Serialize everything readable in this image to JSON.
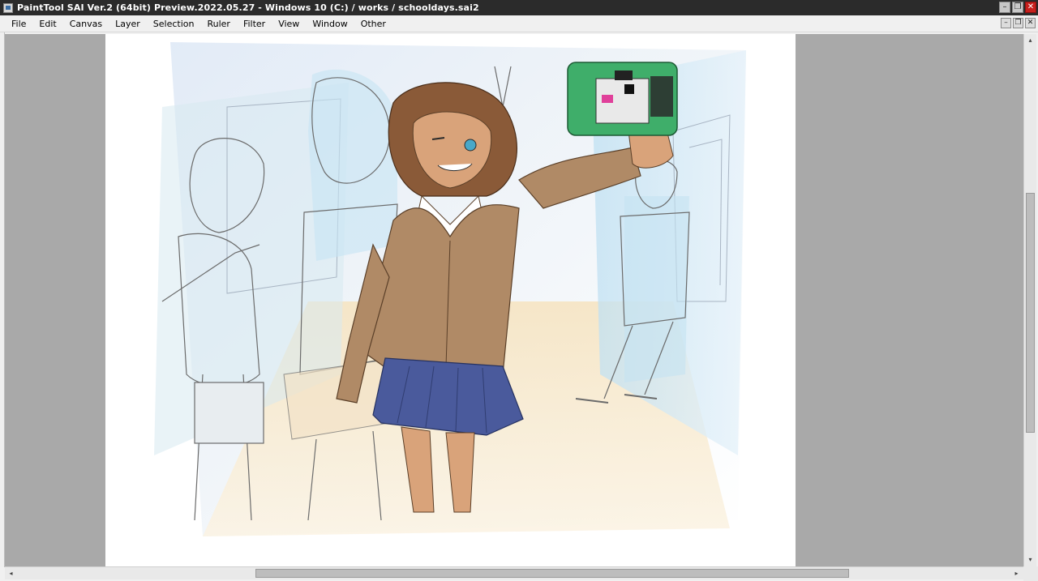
{
  "window": {
    "title": "PaintTool SAI Ver.2 (64bit) Preview.2022.05.27 - Windows 10 (C:) / works / schooldays.sai2",
    "buttons": {
      "minimize": "–",
      "restore": "❐",
      "close": "✕"
    }
  },
  "menu": {
    "items": [
      "File",
      "Edit",
      "Canvas",
      "Layer",
      "Selection",
      "Ruler",
      "Filter",
      "View",
      "Window",
      "Other"
    ]
  },
  "mdi_buttons": {
    "minimize": "–",
    "restore": "❐",
    "close": "✕"
  },
  "scrollbars": {
    "horizontal": {
      "left_arrow": "◂",
      "right_arrow": "▸",
      "position": 0.27,
      "visible_fraction": 0.58
    },
    "vertical": {
      "up_arrow": "▴",
      "down_arrow": "▾",
      "position": 0.3,
      "visible_fraction": 0.45
    }
  },
  "colors": {
    "titlebar": "#2b2b2b",
    "workspace": "#a9a9a9",
    "paper": "#ffffff",
    "close_button": "#c8201d",
    "skirt": "#4a5a9c",
    "cardigan": "#b08a66",
    "hair": "#8a5a38",
    "camera": "#3fae6a"
  }
}
